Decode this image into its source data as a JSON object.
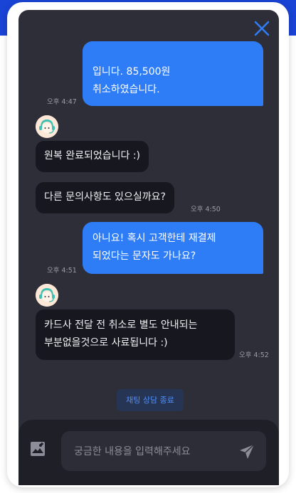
{
  "header": {
    "close_icon": "close-icon"
  },
  "messages": [
    {
      "type": "outgoing",
      "lines": [
        "입니다. 85,500원",
        "취소하였습니다."
      ],
      "time": "오후 4:47"
    },
    {
      "type": "incoming",
      "lines": [
        "원복 완료되었습니다 :)"
      ]
    },
    {
      "type": "incoming",
      "lines": [
        "다른 문의사항도 있으실까요?"
      ],
      "time": "오후 4:50"
    },
    {
      "type": "outgoing",
      "lines": [
        "아니요! 혹시 고객한테 재결제",
        "되었다는 문자도 가나요?"
      ],
      "time": "오후 4:51"
    },
    {
      "type": "incoming",
      "lines": [
        "카드사 전달 전 취소로 별도 안내되는",
        "부분없을것으로 사료됩니다 :)"
      ],
      "time": "오후 4:52"
    }
  ],
  "end_chat_label": "채팅 상담 종료",
  "composer": {
    "placeholder": "궁금한 내용을 입력해주세요",
    "image_icon": "image-icon",
    "send_icon": "send-icon"
  },
  "colors": {
    "outgoing_bubble": "#2f7df6",
    "incoming_bubble": "#17181f",
    "chat_background": "#2d2e38",
    "top_band": "#1a44d6",
    "end_button_text": "#4f8ef7"
  }
}
